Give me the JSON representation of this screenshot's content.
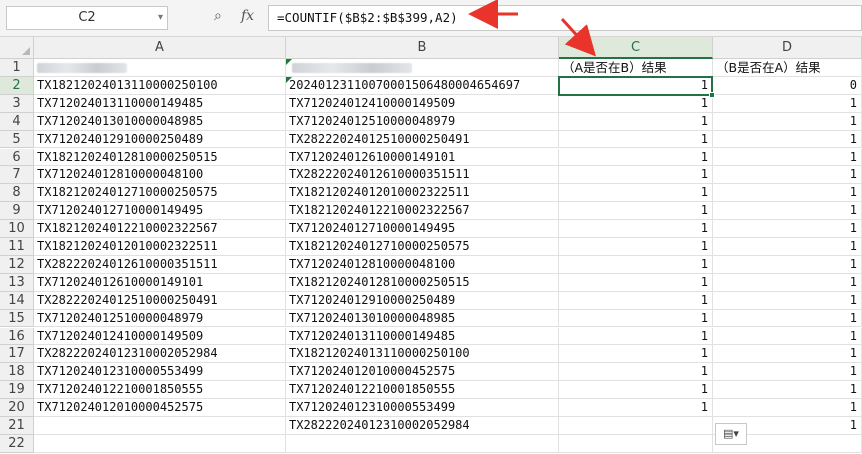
{
  "formula_bar": {
    "name_box": "C2",
    "cancel_icon": "magnify-icon",
    "fx_label": "fx",
    "formula": "=COUNTIF($B$2:$B$399,A2)"
  },
  "columns": [
    "A",
    "B",
    "C",
    "D"
  ],
  "rows": [
    "1",
    "2",
    "3",
    "4",
    "5",
    "6",
    "7",
    "8",
    "9",
    "10",
    "11",
    "12",
    "13",
    "14",
    "15",
    "16",
    "17",
    "18",
    "19",
    "20",
    "21",
    "22"
  ],
  "header_row": {
    "c": "（A是否在B）结果",
    "d": "（B是否在A）结果"
  },
  "cells": {
    "a": [
      "TX18212024013110000250100",
      "TX71202401311000014948​5",
      "TX7120240130100000489​85",
      "TX712024012910000250489",
      "TX182120240128100002505​15",
      "TX712024012810000048100",
      "TX182120240127100002505​75",
      "TX712024012710000149495",
      "TX182120240122100023225​67",
      "TX182120240120100023225​11",
      "TX282220240126100003515​11",
      "TX712024012610000149101",
      "TX282220240125100002504​91",
      "TX712024012510000048979",
      "TX712024012410000149509",
      "TX282220240123100020529​84",
      "TX712024012310000553499",
      "TX712024012210001850555",
      "TX712024012010000452575"
    ],
    "b": [
      "20240123110070001506480004654697",
      "TX712024012410000149509",
      "TX712024012510000048979",
      "TX282220240125100002504​91",
      "TX712024012610000149101",
      "TX282220240126100003515​11",
      "TX182120240120100023225​11",
      "TX182120240122100023225​67",
      "TX712024012710000149495",
      "TX182120240127100002505​75",
      "TX712024012810000048100",
      "TX182120240128100002505​15",
      "TX712024012910000250489",
      "TX7120240130100000489​85",
      "TX71202401311000014948​5",
      "TX18212024013110000250100",
      "TX712024012010000452575",
      "TX712024012210001850555",
      "TX712024012310000553499",
      "TX282220240123100020529​84"
    ],
    "c": [
      "1",
      "1",
      "1",
      "1",
      "1",
      "1",
      "1",
      "1",
      "1",
      "1",
      "1",
      "1",
      "1",
      "1",
      "1",
      "1",
      "1",
      "1",
      "1"
    ],
    "d": [
      "0",
      "1",
      "1",
      "1",
      "1",
      "1",
      "1",
      "1",
      "1",
      "1",
      "1",
      "1",
      "1",
      "1",
      "1",
      "1",
      "1",
      "1",
      "1",
      "1"
    ]
  },
  "paste_options_icon": "paste-options-icon",
  "colors": {
    "accent": "#217346",
    "arrow": "#e8342a"
  }
}
